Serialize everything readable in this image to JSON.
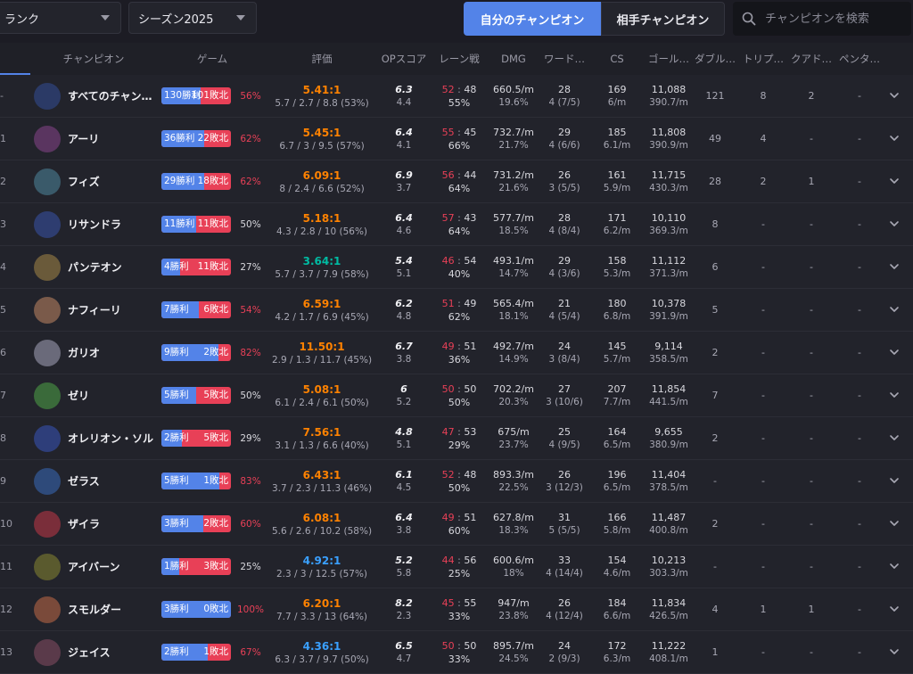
{
  "colors": {
    "accent": "#5383e8",
    "win": "#5383e8",
    "loss": "#e84057",
    "kda_orange": "#ff8200",
    "kda_teal": "#00bba3",
    "kda_blue": "#3aa0ff"
  },
  "filters": {
    "queue": "ランク",
    "season": "シーズン2025"
  },
  "tabs": {
    "mine": "自分のチャンピオン",
    "opponent": "相手チャンピオン"
  },
  "search": {
    "placeholder": "チャンピオンを検索"
  },
  "headers": {
    "champion": "チャンピオン",
    "games": "ゲーム",
    "rating": "評価",
    "op": "OPスコア",
    "lane": "レーン戦",
    "dmg": "DMG",
    "wards": "ワード…",
    "cs": "CS",
    "gold": "ゴール…",
    "double": "ダブル…",
    "triple": "トリプ…",
    "quadra": "クアド…",
    "penta": "ペンタ…"
  },
  "rows": [
    {
      "idx": "-",
      "champ": "すべてのチャン…",
      "wins": "130勝利",
      "losses": "101敗北",
      "wr": 0.56,
      "pct": "56%",
      "pct_color": "red",
      "kda": "5.41:1",
      "kda_color": "orange",
      "kda_detail": "5.7 / 2.7 / 8.8 (53%)",
      "op_a": "6.3",
      "op_b": "4.4",
      "lane_a": "52",
      "lane_b": "48",
      "lane_c": "55%",
      "dmg_a": "660.5/m",
      "dmg_b": "19.6%",
      "gp_a": "28",
      "gp_b": "4 (7/5)",
      "cs_a": "169",
      "cs_b": "6/m",
      "gold_a": "11,088",
      "gold_b": "390.7/m",
      "dk": "121",
      "tk": "8",
      "qk": "2",
      "pk": "-"
    },
    {
      "idx": "1",
      "champ": "アーリ",
      "wins": "36勝利",
      "losses": "22敗北",
      "wr": 0.62,
      "pct": "62%",
      "pct_color": "red",
      "kda": "5.45:1",
      "kda_color": "orange",
      "kda_detail": "6.7 / 3 / 9.5 (57%)",
      "op_a": "6.4",
      "op_b": "4.1",
      "lane_a": "55",
      "lane_b": "45",
      "lane_c": "66%",
      "dmg_a": "732.7/m",
      "dmg_b": "21.7%",
      "gp_a": "29",
      "gp_b": "4 (6/6)",
      "cs_a": "185",
      "cs_b": "6.1/m",
      "gold_a": "11,808",
      "gold_b": "390.9/m",
      "dk": "49",
      "tk": "4",
      "qk": "-",
      "pk": "-"
    },
    {
      "idx": "2",
      "champ": "フィズ",
      "wins": "29勝利",
      "losses": "18敗北",
      "wr": 0.62,
      "pct": "62%",
      "pct_color": "red",
      "kda": "6.09:1",
      "kda_color": "orange",
      "kda_detail": "8 / 2.4 / 6.6 (52%)",
      "op_a": "6.9",
      "op_b": "3.7",
      "lane_a": "56",
      "lane_b": "44",
      "lane_c": "64%",
      "dmg_a": "731.2/m",
      "dmg_b": "21.6%",
      "gp_a": "26",
      "gp_b": "3 (5/5)",
      "cs_a": "161",
      "cs_b": "5.9/m",
      "gold_a": "11,715",
      "gold_b": "430.3/m",
      "dk": "28",
      "tk": "2",
      "qk": "1",
      "pk": "-"
    },
    {
      "idx": "3",
      "champ": "リサンドラ",
      "wins": "11勝利",
      "losses": "11敗北",
      "wr": 0.5,
      "pct": "50%",
      "pct_color": "grey",
      "kda": "5.18:1",
      "kda_color": "orange",
      "kda_detail": "4.3 / 2.8 / 10 (56%)",
      "op_a": "6.4",
      "op_b": "4.6",
      "lane_a": "57",
      "lane_b": "43",
      "lane_c": "64%",
      "dmg_a": "577.7/m",
      "dmg_b": "18.5%",
      "gp_a": "28",
      "gp_b": "4 (8/4)",
      "cs_a": "171",
      "cs_b": "6.2/m",
      "gold_a": "10,110",
      "gold_b": "369.3/m",
      "dk": "8",
      "tk": "-",
      "qk": "-",
      "pk": "-"
    },
    {
      "idx": "4",
      "champ": "パンテオン",
      "wins": "4勝利",
      "losses": "11敗北",
      "wr": 0.27,
      "pct": "27%",
      "pct_color": "grey",
      "kda": "3.64:1",
      "kda_color": "teal",
      "kda_detail": "5.7 / 3.7 / 7.9 (58%)",
      "op_a": "5.4",
      "op_b": "5.1",
      "lane_a": "46",
      "lane_b": "54",
      "lane_c": "40%",
      "dmg_a": "493.1/m",
      "dmg_b": "14.7%",
      "gp_a": "29",
      "gp_b": "4 (3/6)",
      "cs_a": "158",
      "cs_b": "5.3/m",
      "gold_a": "11,112",
      "gold_b": "371.3/m",
      "dk": "6",
      "tk": "-",
      "qk": "-",
      "pk": "-"
    },
    {
      "idx": "5",
      "champ": "ナフィーリ",
      "wins": "7勝利",
      "losses": "6敗北",
      "wr": 0.54,
      "pct": "54%",
      "pct_color": "red",
      "kda": "6.59:1",
      "kda_color": "orange",
      "kda_detail": "4.2 / 1.7 / 6.9 (45%)",
      "op_a": "6.2",
      "op_b": "4.8",
      "lane_a": "51",
      "lane_b": "49",
      "lane_c": "62%",
      "dmg_a": "565.4/m",
      "dmg_b": "18.1%",
      "gp_a": "21",
      "gp_b": "4 (5/4)",
      "cs_a": "180",
      "cs_b": "6.8/m",
      "gold_a": "10,378",
      "gold_b": "391.9/m",
      "dk": "5",
      "tk": "-",
      "qk": "-",
      "pk": "-"
    },
    {
      "idx": "6",
      "champ": "ガリオ",
      "wins": "9勝利",
      "losses": "2敗北",
      "wr": 0.82,
      "pct": "82%",
      "pct_color": "red",
      "kda": "11.50:1",
      "kda_color": "orange",
      "kda_detail": "2.9 / 1.3 / 11.7 (45%)",
      "op_a": "6.7",
      "op_b": "3.8",
      "lane_a": "49",
      "lane_b": "51",
      "lane_c": "36%",
      "dmg_a": "492.7/m",
      "dmg_b": "14.9%",
      "gp_a": "24",
      "gp_b": "3 (8/4)",
      "cs_a": "145",
      "cs_b": "5.7/m",
      "gold_a": "9,114",
      "gold_b": "358.5/m",
      "dk": "2",
      "tk": "-",
      "qk": "-",
      "pk": "-"
    },
    {
      "idx": "7",
      "champ": "ゼリ",
      "wins": "5勝利",
      "losses": "5敗北",
      "wr": 0.5,
      "pct": "50%",
      "pct_color": "grey",
      "kda": "5.08:1",
      "kda_color": "orange",
      "kda_detail": "6.1 / 2.4 / 6.1 (50%)",
      "op_a": "6",
      "op_b": "5.2",
      "lane_a": "50",
      "lane_b": "50",
      "lane_c": "50%",
      "dmg_a": "702.2/m",
      "dmg_b": "20.3%",
      "gp_a": "27",
      "gp_b": "3 (10/6)",
      "cs_a": "207",
      "cs_b": "7.7/m",
      "gold_a": "11,854",
      "gold_b": "441.5/m",
      "dk": "7",
      "tk": "-",
      "qk": "-",
      "pk": "-"
    },
    {
      "idx": "8",
      "champ": "オレリオン・ソル",
      "wins": "2勝利",
      "losses": "5敗北",
      "wr": 0.29,
      "pct": "29%",
      "pct_color": "grey",
      "kda": "7.56:1",
      "kda_color": "orange",
      "kda_detail": "3.1 / 1.3 / 6.6 (40%)",
      "op_a": "4.8",
      "op_b": "5.1",
      "lane_a": "47",
      "lane_b": "53",
      "lane_c": "29%",
      "dmg_a": "675/m",
      "dmg_b": "23.7%",
      "gp_a": "25",
      "gp_b": "4 (9/5)",
      "cs_a": "164",
      "cs_b": "6.5/m",
      "gold_a": "9,655",
      "gold_b": "380.9/m",
      "dk": "2",
      "tk": "-",
      "qk": "-",
      "pk": "-"
    },
    {
      "idx": "9",
      "champ": "ゼラス",
      "wins": "5勝利",
      "losses": "1敗北",
      "wr": 0.83,
      "pct": "83%",
      "pct_color": "red",
      "kda": "6.43:1",
      "kda_color": "orange",
      "kda_detail": "3.7 / 2.3 / 11.3 (46%)",
      "op_a": "6.1",
      "op_b": "4.5",
      "lane_a": "52",
      "lane_b": "48",
      "lane_c": "50%",
      "dmg_a": "893.3/m",
      "dmg_b": "22.5%",
      "gp_a": "26",
      "gp_b": "3 (12/3)",
      "cs_a": "196",
      "cs_b": "6.5/m",
      "gold_a": "11,404",
      "gold_b": "378.5/m",
      "dk": "-",
      "tk": "-",
      "qk": "-",
      "pk": "-"
    },
    {
      "idx": "10",
      "champ": "ザイラ",
      "wins": "3勝利",
      "losses": "2敗北",
      "wr": 0.6,
      "pct": "60%",
      "pct_color": "red",
      "kda": "6.08:1",
      "kda_color": "orange",
      "kda_detail": "5.6 / 2.6 / 10.2 (58%)",
      "op_a": "6.4",
      "op_b": "3.8",
      "lane_a": "49",
      "lane_b": "51",
      "lane_c": "60%",
      "dmg_a": "627.8/m",
      "dmg_b": "18.3%",
      "gp_a": "31",
      "gp_b": "5 (5/5)",
      "cs_a": "166",
      "cs_b": "5.8/m",
      "gold_a": "11,487",
      "gold_b": "400.8/m",
      "dk": "2",
      "tk": "-",
      "qk": "-",
      "pk": "-"
    },
    {
      "idx": "11",
      "champ": "アイバーン",
      "wins": "1勝利",
      "losses": "3敗北",
      "wr": 0.25,
      "pct": "25%",
      "pct_color": "grey",
      "kda": "4.92:1",
      "kda_color": "blue",
      "kda_detail": "2.3 / 3 / 12.5 (57%)",
      "op_a": "5.2",
      "op_b": "5.8",
      "lane_a": "44",
      "lane_b": "56",
      "lane_c": "25%",
      "dmg_a": "600.6/m",
      "dmg_b": "18%",
      "gp_a": "33",
      "gp_b": "4 (14/4)",
      "cs_a": "154",
      "cs_b": "4.6/m",
      "gold_a": "10,213",
      "gold_b": "303.3/m",
      "dk": "-",
      "tk": "-",
      "qk": "-",
      "pk": "-"
    },
    {
      "idx": "12",
      "champ": "スモルダー",
      "wins": "3勝利",
      "losses": "0敗北",
      "wr": 1.0,
      "pct": "100%",
      "pct_color": "red",
      "kda": "6.20:1",
      "kda_color": "orange",
      "kda_detail": "7.7 / 3.3 / 13 (64%)",
      "op_a": "8.2",
      "op_b": "2.3",
      "lane_a": "45",
      "lane_b": "55",
      "lane_c": "33%",
      "dmg_a": "947/m",
      "dmg_b": "23.8%",
      "gp_a": "26",
      "gp_b": "4 (12/4)",
      "cs_a": "184",
      "cs_b": "6.6/m",
      "gold_a": "11,834",
      "gold_b": "426.5/m",
      "dk": "4",
      "tk": "1",
      "qk": "1",
      "pk": "-"
    },
    {
      "idx": "13",
      "champ": "ジェイス",
      "wins": "2勝利",
      "losses": "1敗北",
      "wr": 0.67,
      "pct": "67%",
      "pct_color": "red",
      "kda": "4.36:1",
      "kda_color": "blue",
      "kda_detail": "6.3 / 3.7 / 9.7 (50%)",
      "op_a": "6.5",
      "op_b": "4.7",
      "lane_a": "50",
      "lane_b": "50",
      "lane_c": "33%",
      "dmg_a": "895.7/m",
      "dmg_b": "24.5%",
      "gp_a": "24",
      "gp_b": "2 (9/3)",
      "cs_a": "172",
      "cs_b": "6.3/m",
      "gold_a": "11,222",
      "gold_b": "408.1/m",
      "dk": "1",
      "tk": "-",
      "qk": "-",
      "pk": "-"
    }
  ]
}
